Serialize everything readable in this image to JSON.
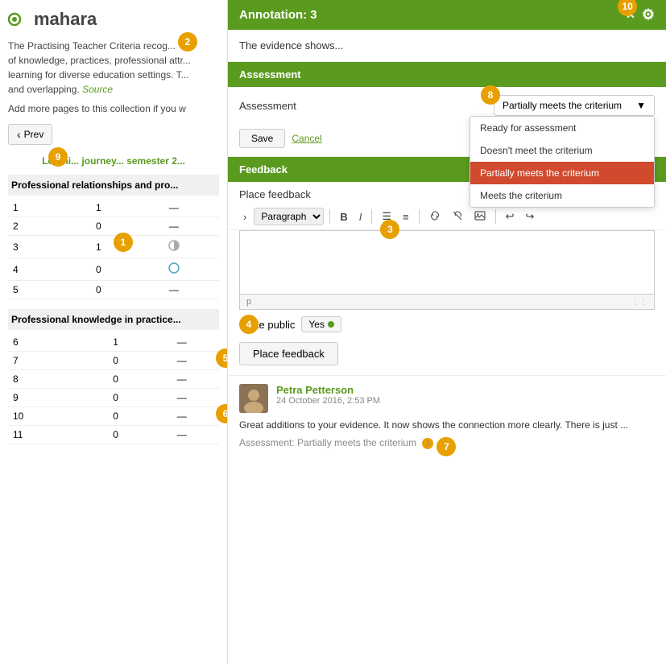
{
  "app": {
    "name": "mahara"
  },
  "left": {
    "intro": "The Practising Teacher Criteria recog... of knowledge, practices, professional attr... learning for diverse education settings. T... and overlapping.",
    "source_link": "Source",
    "add_more": "Add more pages to this collection if you w",
    "prev_button": "Prev",
    "learning_journey": "Learni... journey... semester 2...",
    "sections": [
      {
        "title": "Professional relationships and pro...",
        "rows": [
          {
            "num": "1",
            "col2": "1",
            "col3": "—"
          },
          {
            "num": "2",
            "col2": "0",
            "col3": "—"
          },
          {
            "num": "3",
            "col2": "1",
            "col3": "half"
          },
          {
            "num": "4",
            "col2": "0",
            "col3": "circle"
          },
          {
            "num": "5",
            "col2": "0",
            "col3": "—"
          }
        ]
      },
      {
        "title": "Professional knowledge in practice...",
        "rows": [
          {
            "num": "6",
            "col2": "1",
            "col3": "—"
          },
          {
            "num": "7",
            "col2": "0",
            "col3": "—"
          },
          {
            "num": "8",
            "col2": "0",
            "col3": "—"
          },
          {
            "num": "9",
            "col2": "0",
            "col3": "—"
          },
          {
            "num": "10",
            "col2": "0",
            "col3": "—"
          },
          {
            "num": "11",
            "col2": "0",
            "col3": "—"
          }
        ]
      }
    ]
  },
  "right": {
    "annotation_title": "Annotation: 3",
    "evidence_text": "The evidence shows...",
    "assessment_section": "Assessment",
    "assessment_label": "Assessment",
    "dropdown_value": "Partially meets the criterium",
    "dropdown_options": [
      {
        "label": "Ready for assessment",
        "active": false
      },
      {
        "label": "Doesn't meet the criterium",
        "active": false
      },
      {
        "label": "Partially meets the criterium",
        "active": true
      },
      {
        "label": "Meets the criterium",
        "active": false
      }
    ],
    "save_label": "Save",
    "cancel_label": "Cancel",
    "feedback_section": "Feedback",
    "place_feedback_label": "Place feedback",
    "toolbar": {
      "chevron": "›",
      "paragraph_label": "Paragraph",
      "bold": "B",
      "italic": "I",
      "ul": "≡",
      "ol": "≡",
      "link": "🔗",
      "unlink": "🔗",
      "image": "🖼",
      "undo": "↩",
      "redo": "↪"
    },
    "editor_placeholder": "",
    "editor_footer": "p",
    "make_public_label": "Make public",
    "yes_label": "Yes",
    "place_feedback_btn": "Place feedback",
    "comment": {
      "name": "Petra Petterson",
      "date": "24 October 2016, 2:53 PM",
      "text": "Great additions to your evidence. It now shows the connection more clearly. There is just ...",
      "assessment_note": "Assessment: Partially meets the criterium"
    }
  },
  "badges": {
    "colors": {
      "orange": "#e8a000",
      "green": "#5a9a1f"
    }
  }
}
